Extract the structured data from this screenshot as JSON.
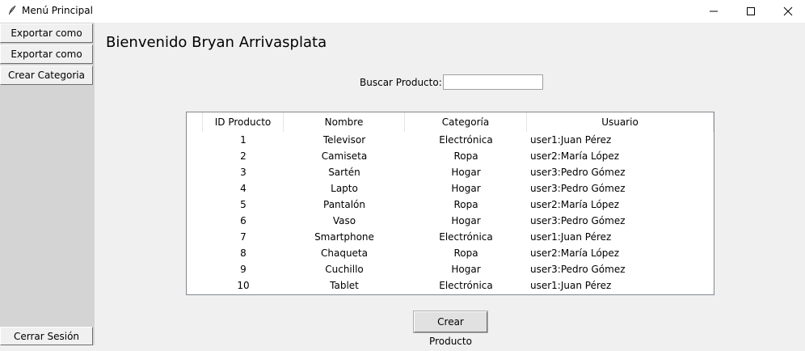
{
  "window": {
    "title": "Menú Principal"
  },
  "sidebar": {
    "buttons": [
      {
        "label": "Exportar como PDF"
      },
      {
        "label": "Exportar como Excel"
      },
      {
        "label": "Crear Categoria"
      }
    ],
    "logout_label": "Cerrar Sesión"
  },
  "main": {
    "welcome": "Bienvenido Bryan Arrivasplata",
    "search": {
      "label": "Buscar Producto:",
      "value": "",
      "placeholder": ""
    },
    "table": {
      "columns": [
        "ID Producto",
        "Nombre",
        "Categoría",
        "Usuario"
      ],
      "rows": [
        [
          "1",
          "Televisor",
          "Electrónica",
          "user1:Juan Pérez"
        ],
        [
          "2",
          "Camiseta",
          "Ropa",
          "user2:María López"
        ],
        [
          "3",
          "Sartén",
          "Hogar",
          "user3:Pedro Gómez"
        ],
        [
          "4",
          "Lapto",
          "Hogar",
          "user3:Pedro Gómez"
        ],
        [
          "5",
          "Pantalón",
          "Ropa",
          "user2:María López"
        ],
        [
          "6",
          "Vaso",
          "Hogar",
          "user3:Pedro Gómez"
        ],
        [
          "7",
          "Smartphone",
          "Electrónica",
          "user1:Juan Pérez"
        ],
        [
          "8",
          "Chaqueta",
          "Ropa",
          "user2:María López"
        ],
        [
          "9",
          "Cuchillo",
          "Hogar",
          "user3:Pedro Gómez"
        ],
        [
          "10",
          "Tablet",
          "Electrónica",
          "user1:Juan Pérez"
        ]
      ]
    },
    "create_button_label": "Crear Producto"
  },
  "colors": {
    "window_bg": "#f0f0f0",
    "sidebar_bg": "#d4d4d4",
    "table_bg": "#ffffff",
    "titlebar_bg": "#ffffff"
  },
  "icons": {
    "app": "feather-icon",
    "minimize": "minimize-icon",
    "maximize": "maximize-icon",
    "close": "close-icon"
  }
}
